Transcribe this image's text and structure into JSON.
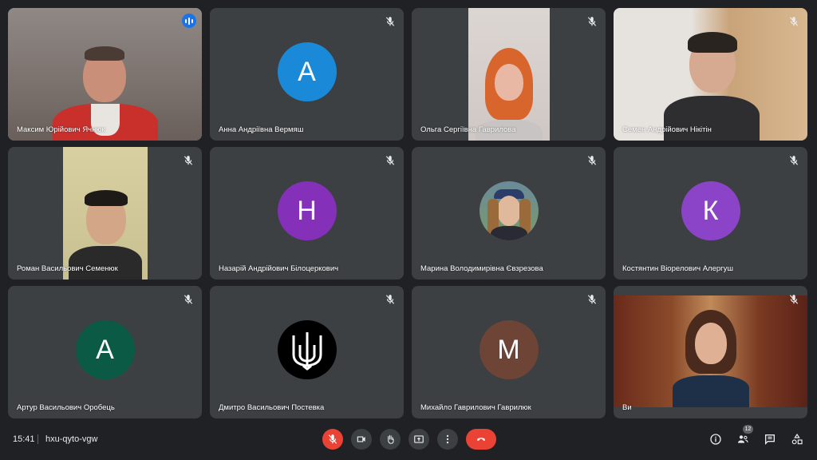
{
  "participants": [
    {
      "name": "Максим Юрійович Ячнюк",
      "type": "video",
      "speaking": true
    },
    {
      "name": "Анна Андріївна Вермяш",
      "type": "avatar",
      "initial": "А",
      "color": "#1a8ad8"
    },
    {
      "name": "Ольга Сергіївна Гаврилова",
      "type": "video"
    },
    {
      "name": "Семен Андрійович Нікітін",
      "type": "video"
    },
    {
      "name": "Роман Васильович Семенюк",
      "type": "video"
    },
    {
      "name": "Назарій Андрійович Білоцеркович",
      "type": "avatar",
      "initial": "Н",
      "color": "#8430b8"
    },
    {
      "name": "Марина Володимирівна Євзрезова",
      "type": "photo-avatar"
    },
    {
      "name": "Костянтин Віорелович Алергуш",
      "type": "avatar",
      "initial": "К",
      "color": "#8b44c8"
    },
    {
      "name": "Артур Васильович Оробець",
      "type": "avatar",
      "initial": "А",
      "color": "#0b5a45"
    },
    {
      "name": "Дмитро Васильович Постевка",
      "type": "emblem-avatar",
      "color": "#000000"
    },
    {
      "name": "Михайло Гаврилович Гаврилюк",
      "type": "avatar",
      "initial": "М",
      "color": "#6d4436"
    },
    {
      "name": "Ви",
      "type": "video"
    }
  ],
  "bottombar": {
    "time": "15:41",
    "meeting_code": "hxu-qyto-vgw",
    "people_count": "12"
  },
  "colors": {
    "background": "#202124",
    "tile": "#3c4043",
    "speaking_outline": "#8ab4f8",
    "danger": "#ea4335"
  }
}
